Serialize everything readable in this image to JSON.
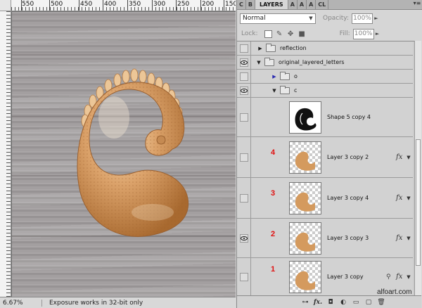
{
  "ruler": {
    "labels": [
      "550",
      "500",
      "450",
      "400",
      "350",
      "300",
      "250",
      "200",
      "150"
    ]
  },
  "status": {
    "zoom": "6.67%",
    "message": "Exposure works in 32-bit only"
  },
  "panel": {
    "tabs": [
      "C",
      "B",
      "LAYERS",
      "A",
      "A",
      "A",
      "CL"
    ],
    "active_tab": "LAYERS",
    "blend_mode": "Normal",
    "opacity_label": "Opacity:",
    "opacity_value": "100%",
    "lock_label": "Lock:",
    "fill_label": "Fill:",
    "fill_value": "100%"
  },
  "layers": [
    {
      "name": "reflection",
      "type": "group",
      "visible": false,
      "expanded": false
    },
    {
      "name": "original_layered_letters",
      "type": "group",
      "visible": true,
      "expanded": true
    },
    {
      "name": "o",
      "type": "group",
      "visible": false,
      "expanded": false
    },
    {
      "name": "c",
      "type": "group",
      "visible": true,
      "expanded": true
    },
    {
      "name": "Shape 5 copy 4",
      "type": "shape",
      "visible": false
    },
    {
      "name": "Layer 3 copy 2",
      "number": "4",
      "type": "pixel",
      "visible": false,
      "fx": true
    },
    {
      "name": "Layer 3 copy 4",
      "number": "3",
      "type": "pixel",
      "visible": false,
      "fx": true
    },
    {
      "name": "Layer 3 copy 3",
      "number": "2",
      "type": "pixel",
      "visible": true,
      "fx": true
    },
    {
      "name": "Layer 3 copy",
      "number": "1",
      "type": "pixel",
      "visible": false,
      "fx": true
    }
  ],
  "footer": {
    "link": "⊶",
    "fx": "fx.",
    "mask": "◘",
    "adjust": "◐",
    "group": "▭",
    "new": "▢",
    "delete": "🗑"
  },
  "icons": {
    "fx": "fx",
    "link": "⚲",
    "panel_menu": "▾≡"
  },
  "watermark": "alfoart.com",
  "colors": {
    "canvas_wood": "#a5a1a2",
    "shell": "#d69a60",
    "layer_number": "#e01010"
  }
}
